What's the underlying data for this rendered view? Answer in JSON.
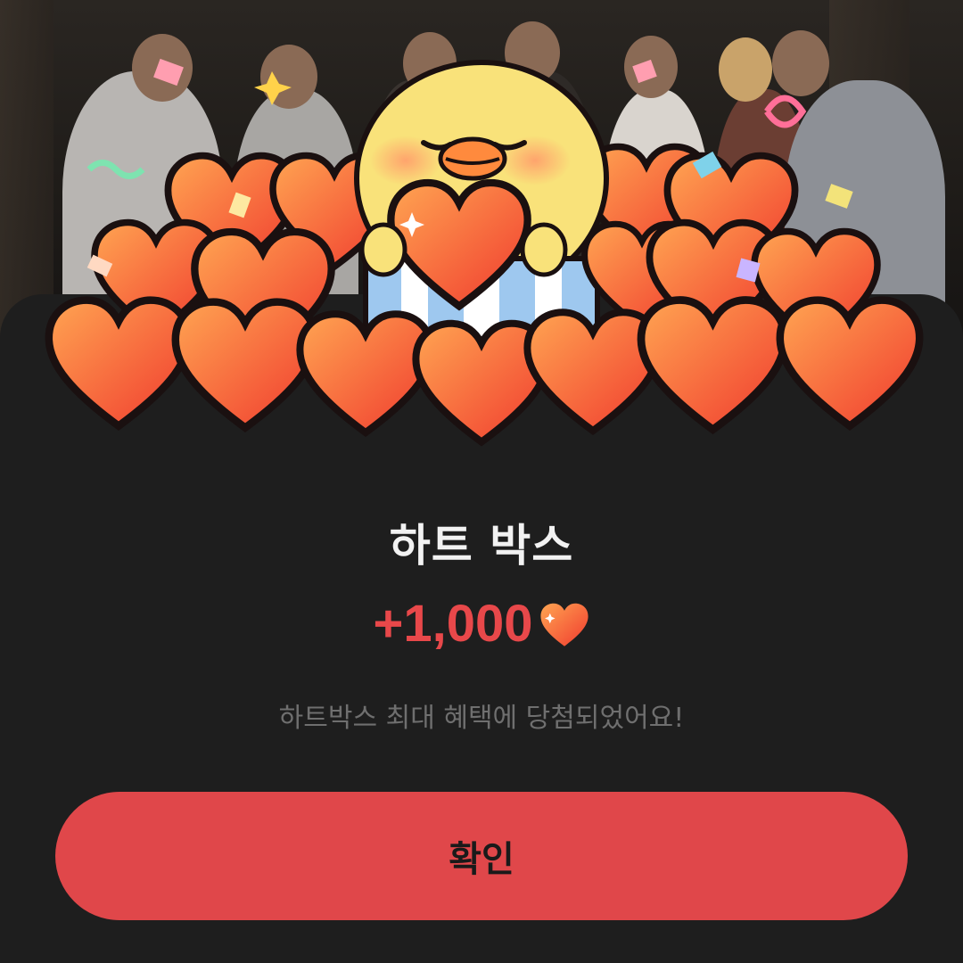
{
  "dialog": {
    "title": "하트 박스",
    "reward_amount": "+1,000",
    "reward_icon": "heart-icon",
    "message": "하트박스 최대 혜택에 당첨되었어요!",
    "confirm_label": "확인"
  },
  "colors": {
    "accent": "#e0474a",
    "amount_text": "#e8484a",
    "background": "#1e1e1e",
    "title_text": "#f2f2f2",
    "message_text": "#6f6f6f",
    "heart_light": "#ff9a4d",
    "heart_dark": "#f0402f",
    "chick_yellow": "#f9e27a"
  }
}
